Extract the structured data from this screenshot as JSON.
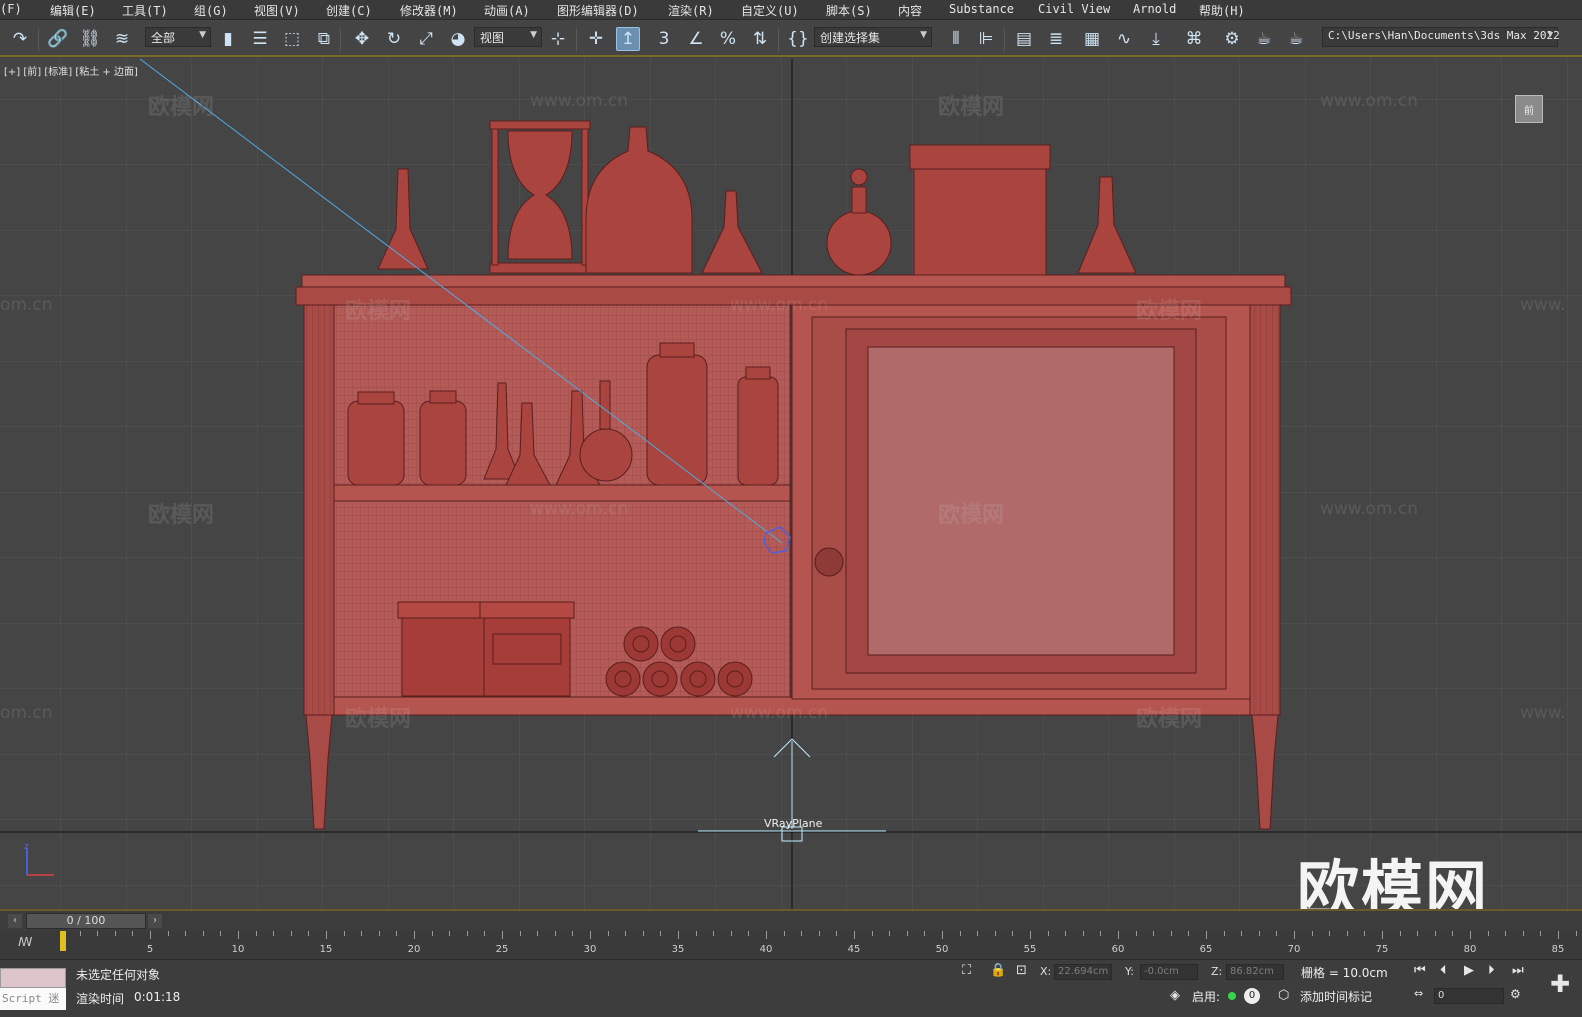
{
  "menu": {
    "items": [
      "(F)",
      "编辑(E)",
      "工具(T)",
      "组(G)",
      "视图(V)",
      "创建(C)",
      "修改器(M)",
      "动画(A)",
      "图形编辑器(D)",
      "渲染(R)",
      "自定义(U)",
      "脚本(S)",
      "内容",
      "Substance",
      "Civil View",
      "Arnold",
      "帮助(H)"
    ]
  },
  "toolbar": {
    "filter_selected": "全部",
    "ref_coord_selected": "视图",
    "selection_set_placeholder": "创建选择集",
    "snap_label": "3",
    "project_path": "C:\\Users\\Han\\Documents\\3ds Max 2022"
  },
  "viewport": {
    "label": "[+] [前] [标准] [粘土 + 边面]",
    "object_label": "VRayPlane",
    "navcube_face": "前",
    "watermark_big": "欧模网",
    "watermark_cn": "欧模网",
    "watermark_url": "www.om.cn",
    "watermark_url_partial": "om.cn",
    "watermark_url_partial2": "www.",
    "colors": {
      "model": "#b5554f",
      "wire": "#5a1e1e",
      "grid": "#555555",
      "bg": "#454545",
      "light_line": "#4fa9e0"
    }
  },
  "timeline": {
    "frame_display": "0 / 100",
    "ticks": [
      5,
      10,
      15,
      20,
      25,
      30,
      35,
      40,
      45,
      50,
      55,
      60,
      65,
      70,
      75,
      80,
      85
    ]
  },
  "status": {
    "selection_msg": "未选定任何对象",
    "render_time_label": "渲染时间",
    "render_time_value": "0:01:18",
    "script_label": "Script 迷",
    "x_label": "X:",
    "x_value": "22.694cm",
    "y_label": "Y:",
    "y_value": "-0.0cm",
    "z_label": "Z:",
    "z_value": "86.82cm",
    "grid_label": "栅格 = 10.0cm",
    "enable_label": "启用:",
    "enable_value": "0",
    "add_time_tag": "添加时间标记",
    "frame_field": "0"
  }
}
